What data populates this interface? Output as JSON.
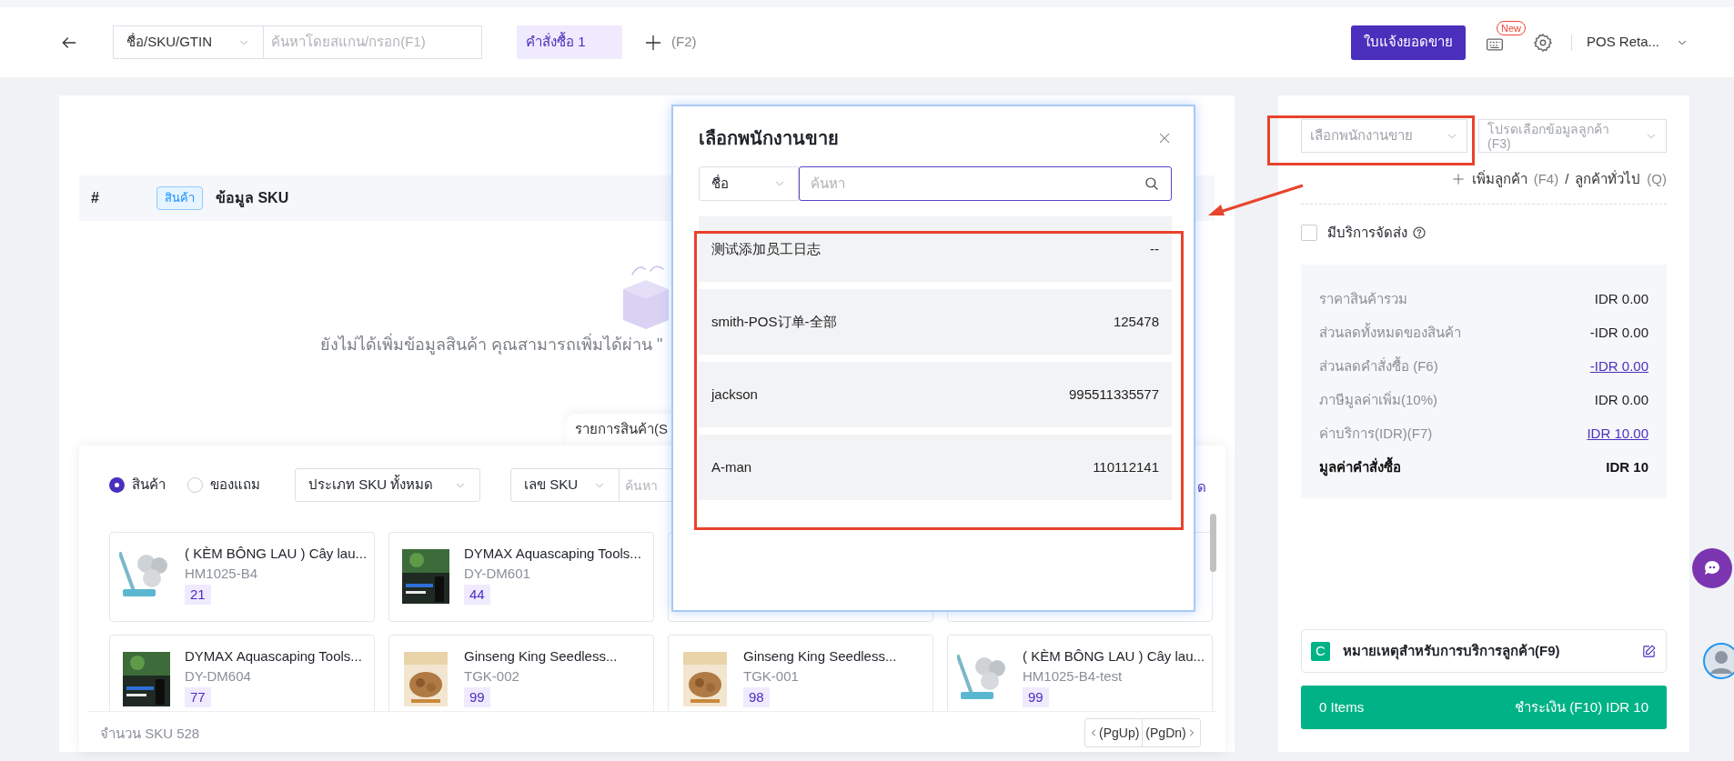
{
  "topbar": {
    "search_type": "ชื่อ/SKU/GTIN",
    "search_placeholder": "ค้นหาโดยสแกน/กรอก(F1)",
    "order_tabs": [
      {
        "label": "คำสั่งซื้อ 1",
        "selected": true
      }
    ],
    "add_order_shortcut": "(F2)",
    "report_button": "ใบแจ้งยอดขาย",
    "new_badge": "New",
    "store": "POS Reta..."
  },
  "order_table": {
    "columns": [
      "#",
      "ข้อมูล SKU"
    ],
    "tag": "สินค้า",
    "empty_text": "ยังไม่ได้เพิ่มข้อมูลสินค้า คุณสามารถเพิ่มได้ผ่าน \""
  },
  "catalog": {
    "tab_label": "รายการสินค้า(S",
    "item_types": [
      {
        "label": "สินค้า",
        "selected": true
      },
      {
        "label": "ของแถม",
        "selected": false
      }
    ],
    "sku_type_select": "ประเภท SKU ทั้งหมด",
    "search_by": "เลข SKU",
    "search_placeholder": "ค้นหา",
    "trailing_text": "ด",
    "product_rows": [
      [
        {
          "name": "( KÈM BÔNG LAU ) Cây lau...",
          "sku": "HM1025-B4",
          "stock": "21",
          "kind": "picture"
        },
        {
          "name": "DYMAX Aquascaping Tools...",
          "sku": "DY-DM601",
          "stock": "44",
          "kind": "picture"
        }
      ],
      [
        {
          "name": "DYMAX Aquascaping Tools...",
          "sku": "DY-DM604",
          "stock": "77",
          "kind": "picture"
        },
        {
          "name": "Ginseng King Seedless...",
          "sku": "TGK-002",
          "stock": "99",
          "kind": "picture"
        },
        {
          "name": "Ginseng King Seedless...",
          "sku": "TGK-001",
          "stock": "98",
          "kind": "picture"
        },
        {
          "name": "( KÈM BÔNG LAU ) Cây lau...",
          "sku": "HM1025-B4-test",
          "stock": "99",
          "kind": "picture"
        }
      ]
    ],
    "sku_count": "จำนวน SKU 528",
    "prev_page": "(PgUp)",
    "next_page": "(PgDn)"
  },
  "modal": {
    "title": "เลือกพนักงานขาย",
    "filter_select": "ชื่อ",
    "search_placeholder": "ค้นหา",
    "staff": [
      {
        "name": "测试添加员工日志",
        "code": "--"
      },
      {
        "name": "smith-POS订单-全部",
        "code": "125478"
      },
      {
        "name": "jackson",
        "code": "995511335577"
      },
      {
        "name": "A-man",
        "code": "110112141"
      }
    ]
  },
  "sidebar": {
    "salesperson_placeholder": "เลือกพนักงานขาย",
    "customer_placeholder": "โปรดเลือกข้อมูลลูกค้า (F3)",
    "add_customer": "เพิ่มลูกค้า",
    "add_customer_key": "(F4)",
    "separator": "/",
    "walk_in_customer": "ลูกค้าทั่วไป",
    "walk_in_key": "(Q)",
    "delivery": {
      "label": "มีบริการจัดส่ง",
      "checked": false
    },
    "summary": [
      {
        "label": "ราคาสินค้ารวม",
        "value": "IDR 0.00",
        "kind": "plain"
      },
      {
        "label": "ส่วนลดทั้งหมดของสินค้า",
        "value": "-IDR 0.00",
        "kind": "plain"
      },
      {
        "label": "ส่วนลดคำสั่งซื้อ (F6)",
        "value": "-IDR 0.00",
        "kind": "link"
      },
      {
        "label": "ภาษีมูลค่าเพิ่ม(10%)",
        "value": "IDR 0.00",
        "kind": "plain"
      },
      {
        "label": "ค่าบริการ(IDR)(F7)",
        "value": "IDR 10.00",
        "kind": "link"
      },
      {
        "label": "มูลค่าคำสั่งซื้อ",
        "value": "IDR 10",
        "kind": "total"
      }
    ],
    "note": {
      "badge": "C",
      "label": "หมายเหตุสำหรับการบริการลูกค้า(F9)"
    },
    "checkout": {
      "items": "0 Items",
      "pay": "ชำระเงิน (F10) IDR 10"
    }
  }
}
